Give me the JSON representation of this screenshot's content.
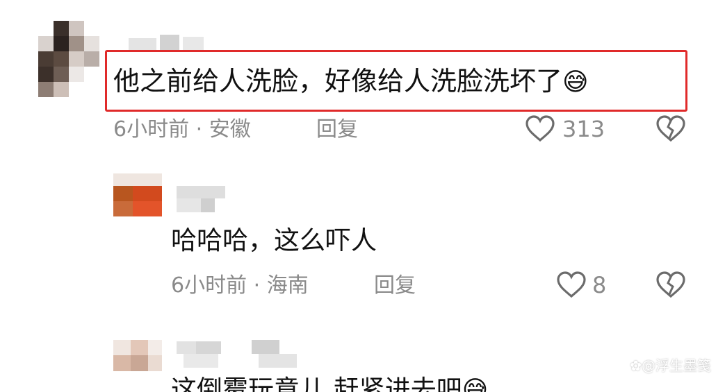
{
  "comments": [
    {
      "text": "他之前给人洗脸，好像给人洗脸洗坏了",
      "emoji": "😅",
      "time": "6小时前",
      "separator": "·",
      "location": "安徽",
      "reply_label": "回复",
      "likes": "313"
    },
    {
      "text": "哈哈哈，这么吓人",
      "time": "6小时前",
      "separator": "·",
      "location": "海南",
      "reply_label": "回复",
      "likes": "8"
    },
    {
      "text": "这倒霉玩意儿 赶紧进去吧",
      "emoji": "😅"
    }
  ],
  "watermark": "@浮生墨笺",
  "colors": {
    "highlight_border": "#e02a2a",
    "text": "#111111",
    "meta": "#8a8a8a"
  }
}
